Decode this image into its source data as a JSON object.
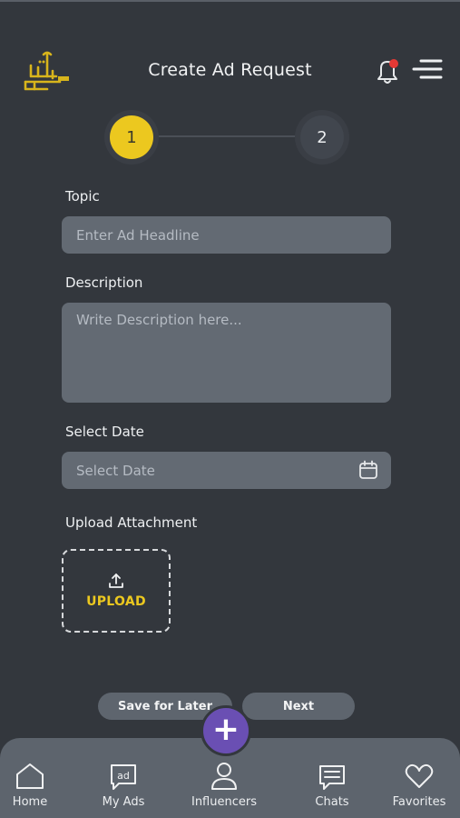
{
  "header": {
    "title": "Create Ad Request",
    "logo_icon": "brand-logo-icon",
    "notification_icon": "bell-icon",
    "menu_icon": "menu-icon"
  },
  "stepper": {
    "steps": [
      "1",
      "2"
    ],
    "active_step": 1
  },
  "form": {
    "topic_label": "Topic",
    "topic_placeholder": "Enter Ad Headline",
    "description_label": "Description",
    "description_placeholder": "Write Description here...",
    "date_label": "Select Date",
    "date_placeholder": "Select Date",
    "attachment_label": "Upload Attachment",
    "upload_label": "UPLOAD"
  },
  "actions": {
    "save_later_label": "Save for Later",
    "next_label": "Next"
  },
  "bottom_nav": {
    "items": [
      {
        "label": "Home",
        "icon": "home-icon"
      },
      {
        "label": "My Ads",
        "icon": "ad-icon"
      },
      {
        "label": "Influencers",
        "icon": "user-icon"
      },
      {
        "label": "Chats",
        "icon": "chat-icon"
      },
      {
        "label": "Favorites",
        "icon": "heart-icon"
      }
    ],
    "fab_icon": "plus-icon"
  },
  "colors": {
    "background": "#33373d",
    "accent_yellow": "#ecc81f",
    "fab_purple": "#6a4fb3",
    "field_bg": "#636a73",
    "notification_dot": "#e53935"
  }
}
